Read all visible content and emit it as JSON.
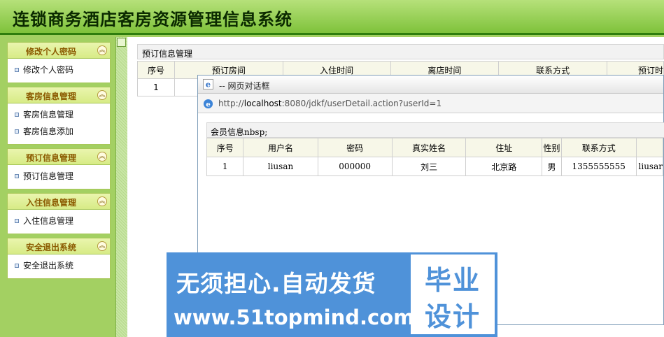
{
  "app": {
    "title": "连锁商务酒店客房资源管理信息系统"
  },
  "sidebar": {
    "groups": [
      {
        "title": "修改个人密码",
        "items": [
          "修改个人密码"
        ]
      },
      {
        "title": "客房信息管理",
        "items": [
          "客房信息管理",
          "客房信息添加"
        ]
      },
      {
        "title": "预订信息管理",
        "items": [
          "预订信息管理"
        ]
      },
      {
        "title": "入住信息管理",
        "items": [
          "入住信息管理"
        ]
      },
      {
        "title": "安全退出系统",
        "items": [
          "安全退出系统"
        ]
      }
    ],
    "collapse_symbol": "︽"
  },
  "main": {
    "panel_title": "预订信息管理",
    "table": {
      "headers": [
        "序号",
        "预订房间",
        "入住时间",
        "离店时间",
        "联系方式",
        "预订时"
      ],
      "rows": [
        [
          "1"
        ]
      ]
    }
  },
  "dialog": {
    "title": "-- 网页对话框",
    "url_prefix": "http://",
    "url_host": "localhost",
    "url_rest": ":8080/jdkf/userDetail.action?userId=1",
    "panel_title": "会员信息nbsp;",
    "table": {
      "headers": [
        "序号",
        "用户名",
        "密码",
        "真实姓名",
        "住址",
        "性别",
        "联系方式",
        ""
      ],
      "rows": [
        [
          "1",
          "liusan",
          "000000",
          "刘三",
          "北京路",
          "男",
          "1355555555",
          "liusar"
        ]
      ]
    }
  },
  "watermark": {
    "line1": "无须担心.自动发货",
    "line2": "www.51topmind.com",
    "right_line1": "毕业",
    "right_line2": "设计"
  }
}
